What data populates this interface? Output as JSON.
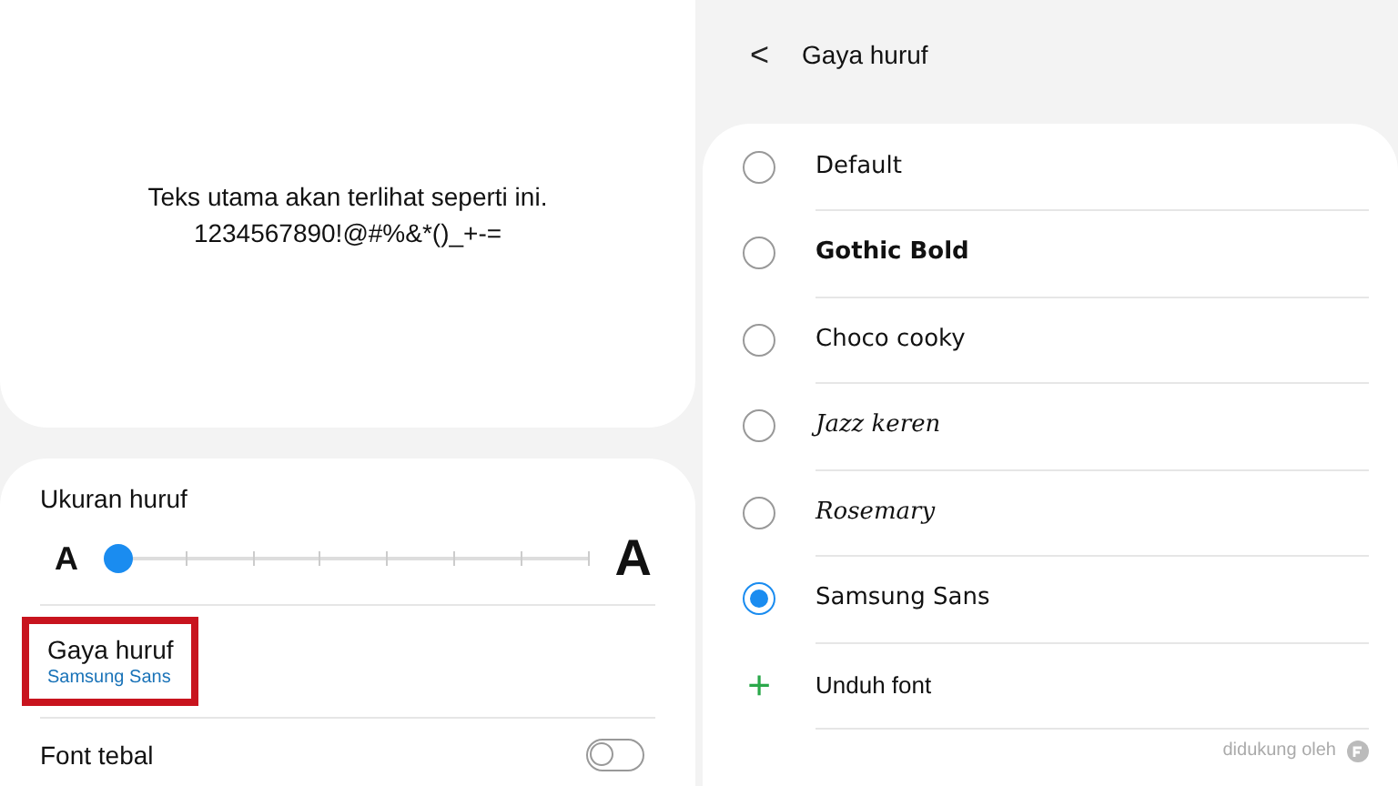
{
  "preview": {
    "text": "Teks utama akan terlihat seperti ini.",
    "sample": "1234567890!@#%&*()_+-="
  },
  "settings": {
    "font_size": {
      "label": "Ukuran huruf",
      "small_glyph": "A",
      "large_glyph": "A",
      "level": 0
    },
    "font_style": {
      "label": "Gaya huruf",
      "value": "Samsung Sans",
      "highlighted": true
    },
    "bold_font": {
      "label": "Font tebal",
      "on": false
    }
  },
  "font_page": {
    "back": "<",
    "title": "Gaya huruf",
    "fonts": [
      {
        "label": "Default",
        "kind": "default",
        "selected": false
      },
      {
        "label": "Gothic Bold",
        "kind": "bold",
        "selected": false
      },
      {
        "label": "Choco cooky",
        "kind": "rounded",
        "selected": false
      },
      {
        "label": "Jazz keren",
        "kind": "script",
        "selected": false
      },
      {
        "label": "Rosemary",
        "kind": "hand",
        "selected": false
      },
      {
        "label": "Samsung Sans",
        "kind": "default",
        "selected": true
      }
    ],
    "download": {
      "icon": "+",
      "label": "Unduh font"
    },
    "footer": "didukung oleh"
  }
}
